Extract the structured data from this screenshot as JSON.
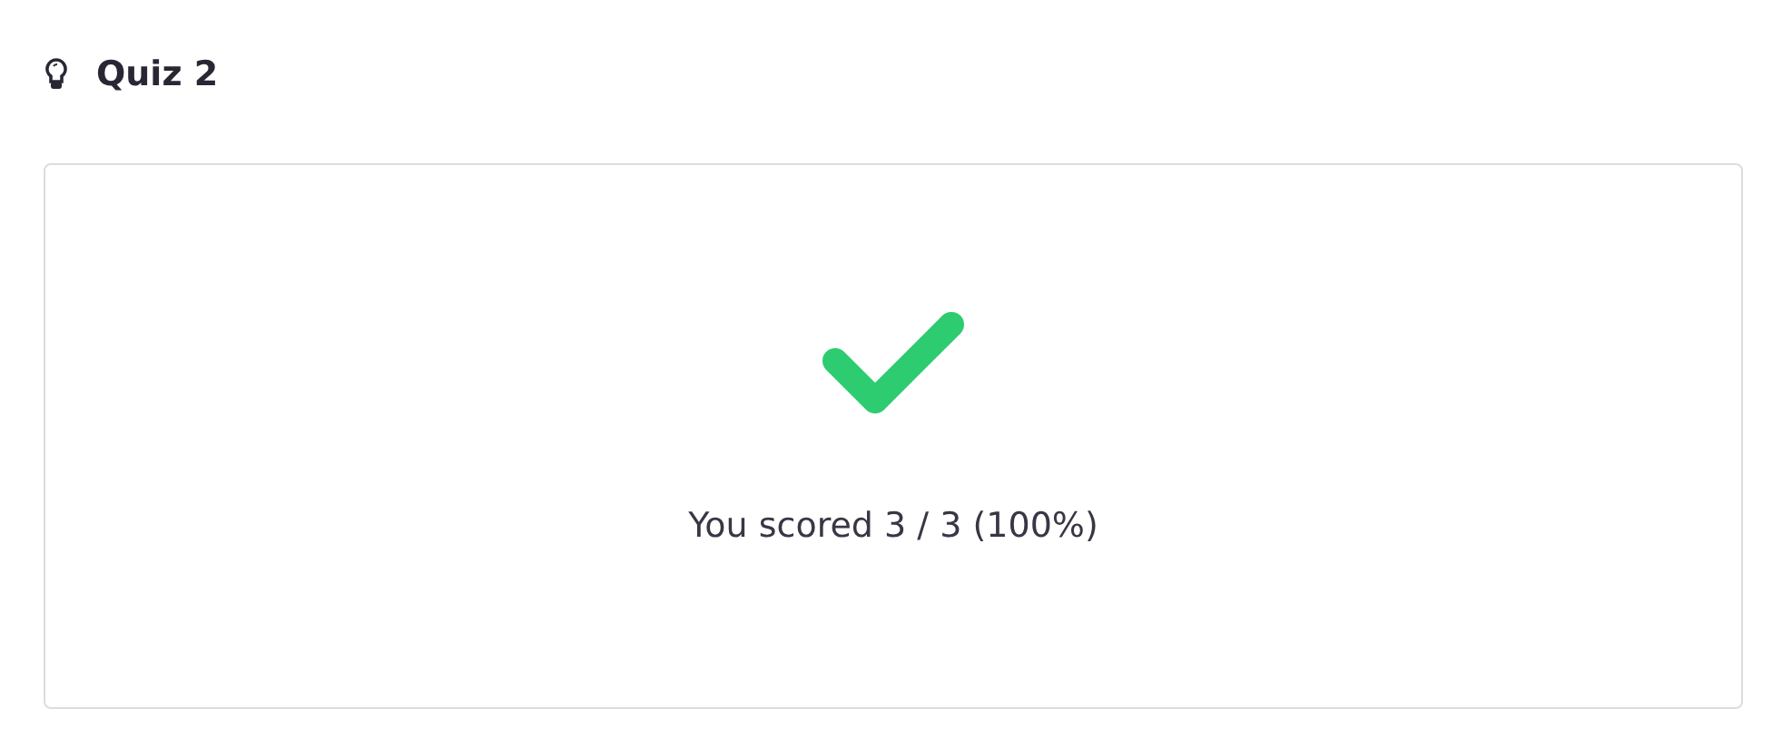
{
  "title": "Quiz 2",
  "result": {
    "passed": true,
    "score": "You scored 3 / 3 (100%)"
  }
}
